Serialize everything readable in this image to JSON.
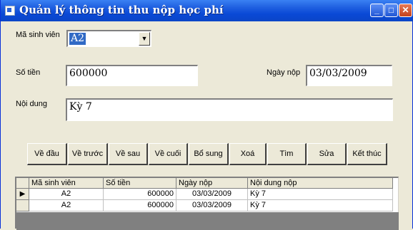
{
  "window": {
    "title": "Quản lý thông tin thu nộp học phí",
    "min_glyph": "_",
    "max_glyph": "□",
    "close_glyph": "✕",
    "icon": "app-icon"
  },
  "form": {
    "student_id_label": "Mã sinh viên",
    "student_id_value": "A2",
    "amount_label": "Số tiền",
    "amount_value": "600000",
    "date_label": "Ngày nộp",
    "date_value": "03/03/2009",
    "content_label": "Nội dung",
    "content_value": "Kỳ 7"
  },
  "buttons": {
    "first": "Về đầu",
    "prev": "Về trước",
    "next": "Về sau",
    "last": "Về cuối",
    "add": "Bổ sung",
    "delete": "Xoá",
    "find": "Tìm",
    "edit": "Sửa",
    "exit": "Kết thúc"
  },
  "grid": {
    "headers": [
      "Mã sinh viên",
      "Số tiền",
      "Ngày nộp",
      "Nội dung nộp"
    ],
    "current_row_marker": "▶",
    "rows": [
      {
        "student_id": "A2",
        "amount": "600000",
        "date": "03/03/2009",
        "content": "Kỳ 7"
      },
      {
        "student_id": "A2",
        "amount": "600000",
        "date": "03/03/2009",
        "content": "Kỳ 7"
      }
    ]
  }
}
